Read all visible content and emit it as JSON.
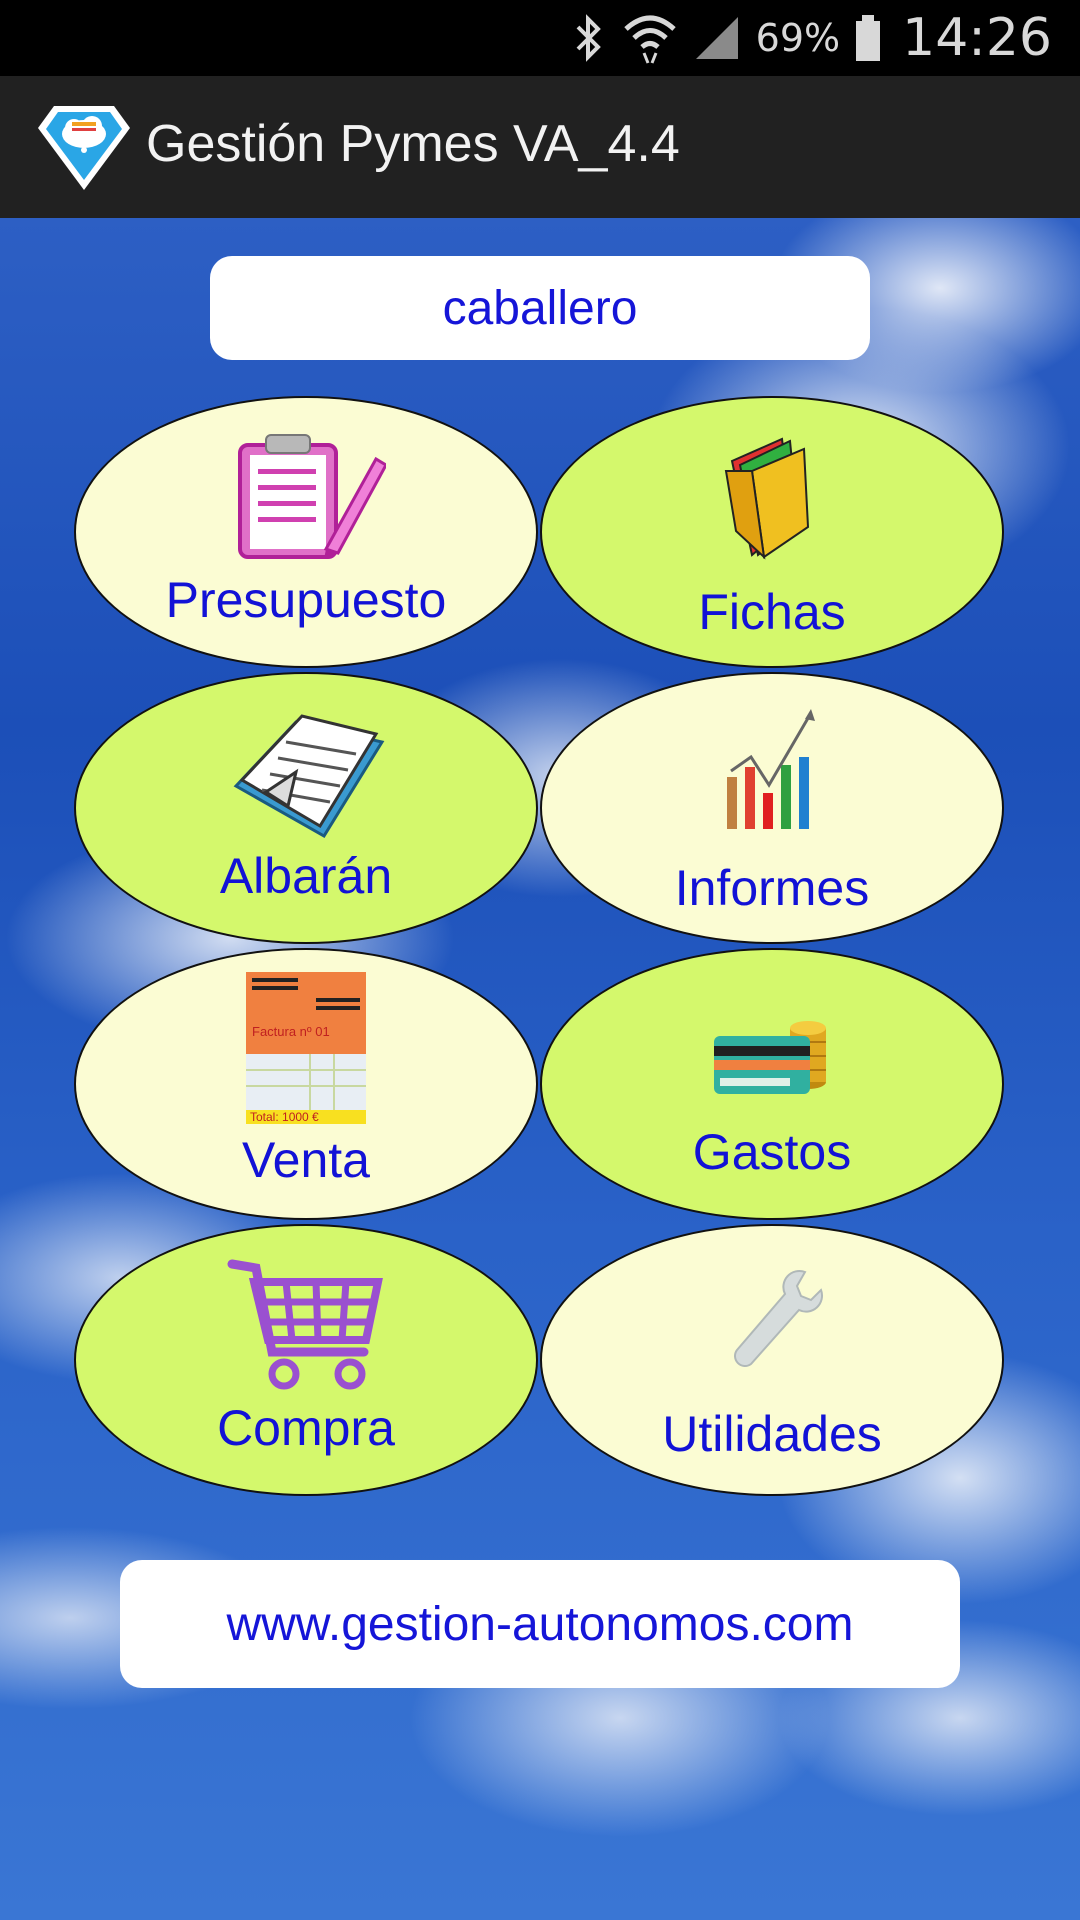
{
  "status_bar": {
    "icons": [
      "bluetooth-icon",
      "wifi-icon",
      "signal-icon",
      "battery-icon"
    ],
    "battery_percent": "69%",
    "time": "14:26"
  },
  "action_bar": {
    "logo_icon": "diamond-cloud-logo",
    "title": "Gestión Pymes VA_4.4"
  },
  "user": {
    "name": "caballero"
  },
  "menu": {
    "tiles": [
      {
        "label": "Presupuesto",
        "icon": "clipboard-pen-icon",
        "color": "#fbfcd3"
      },
      {
        "label": "Fichas",
        "icon": "folders-icon",
        "color": "#d4f86c"
      },
      {
        "label": "Albarán",
        "icon": "notepad-icon",
        "color": "#d4f86c"
      },
      {
        "label": "Informes",
        "icon": "bar-chart-icon",
        "color": "#fbfcd3"
      },
      {
        "label": "Venta",
        "icon": "invoice-icon",
        "color": "#fbfcd3"
      },
      {
        "label": "Gastos",
        "icon": "card-coins-icon",
        "color": "#d4f86c"
      },
      {
        "label": "Compra",
        "icon": "cart-icon",
        "color": "#d4f86c"
      },
      {
        "label": "Utilidades",
        "icon": "wrench-icon",
        "color": "#fbfcd3"
      }
    ],
    "invoice_text": {
      "title": "Factura nº 01",
      "total": "Total: 1000 €"
    }
  },
  "website": {
    "url": "www.gestion-autonomos.com"
  },
  "colors": {
    "label_text": "#1212d6",
    "cream_tile": "#fbfcd3",
    "lime_tile": "#d4f86c",
    "action_bar": "#212121"
  }
}
